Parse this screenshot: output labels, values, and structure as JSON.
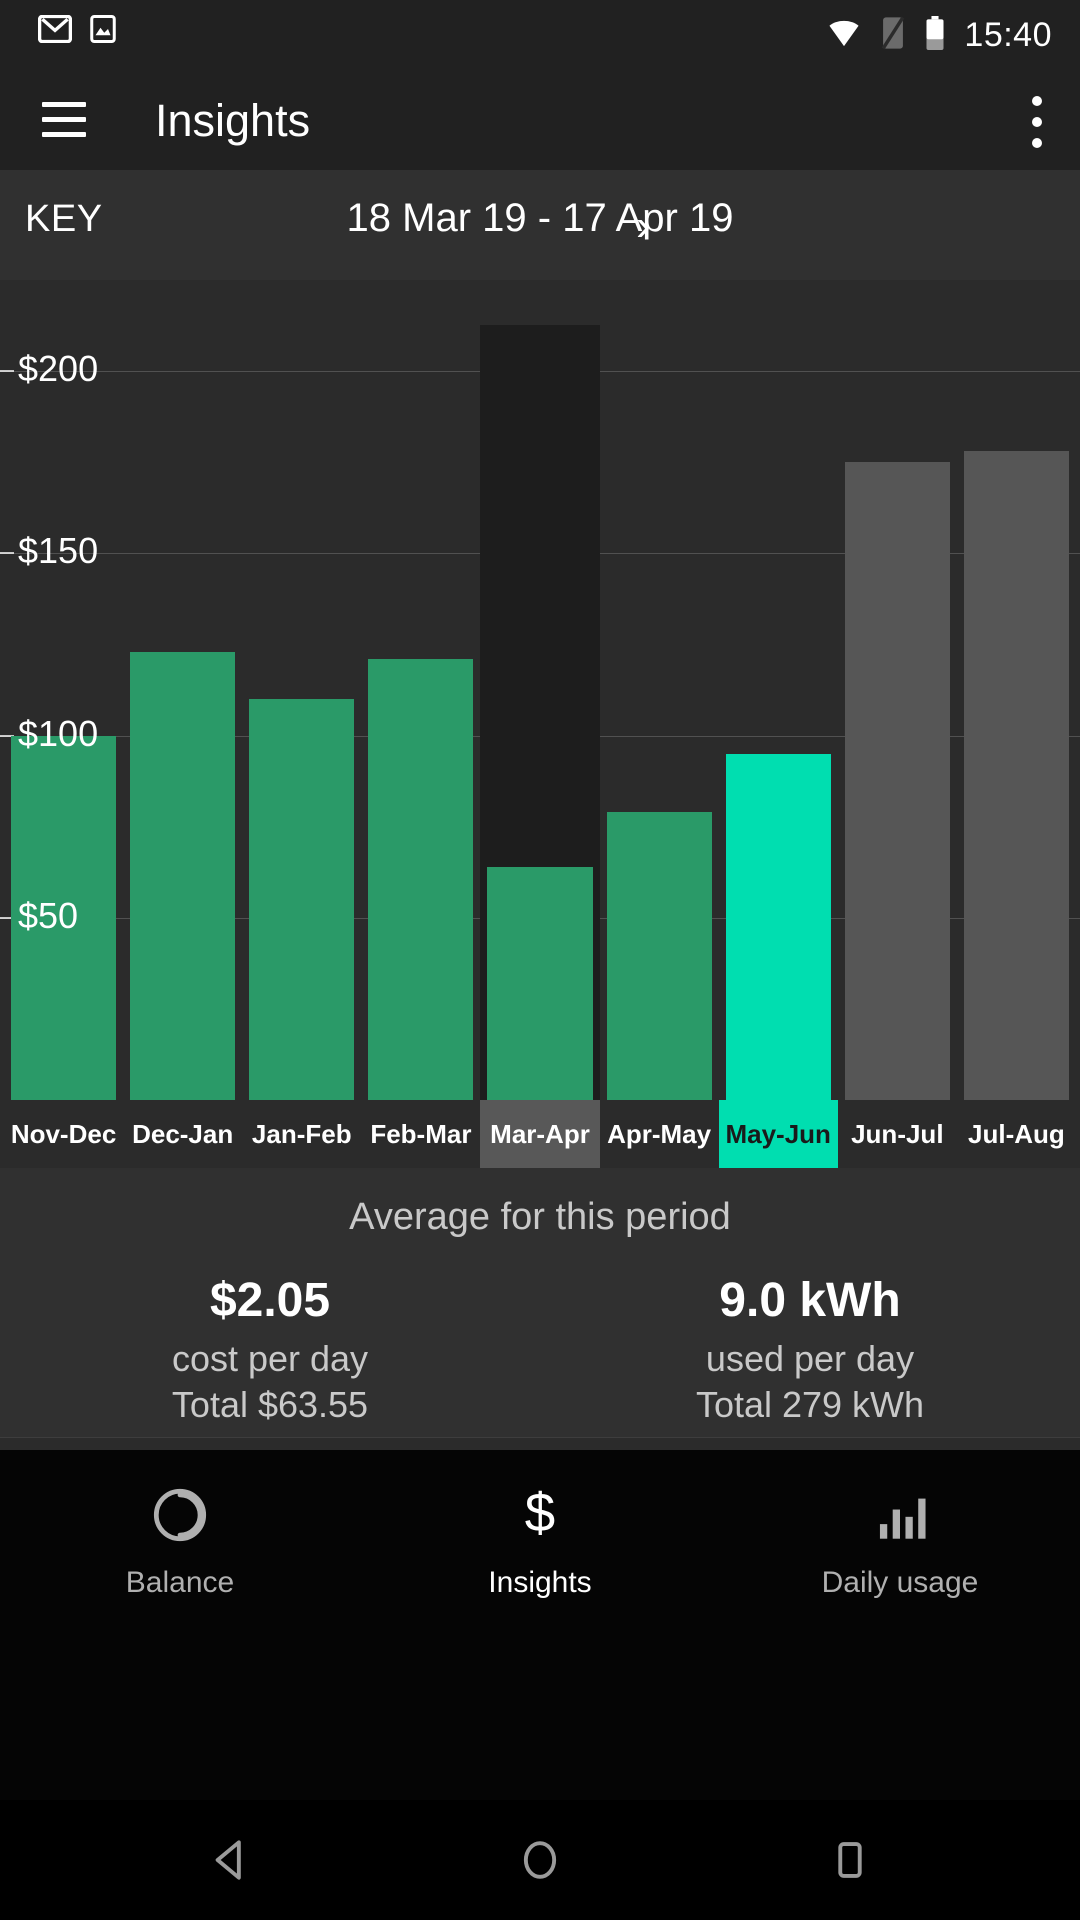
{
  "status_bar": {
    "time": "15:40",
    "icons": [
      "gmail-icon",
      "image-icon",
      "wifi-icon",
      "sim-off-icon",
      "battery-icon"
    ]
  },
  "app_bar": {
    "title": "Insights",
    "menu_icon": "hamburger-icon",
    "overflow_icon": "kebab-menu-icon"
  },
  "range_bar": {
    "key_label": "KEY",
    "range_text": "18 Mar 19 - 17 Apr 19",
    "next_icon": "›"
  },
  "chart_data": {
    "type": "bar",
    "title": "",
    "xlabel": "",
    "ylabel": "",
    "ylim": [
      0,
      225
    ],
    "grid": true,
    "ytick_labels": [
      "$200",
      "$150",
      "$100",
      "$50"
    ],
    "ytick_values": [
      200,
      150,
      100,
      50
    ],
    "categories": [
      "Nov-Dec",
      "Dec-Jan",
      "Jan-Feb",
      "Feb-Mar",
      "Mar-Apr",
      "Apr-May",
      "May-Jun",
      "Jun-Jul",
      "Jul-Aug"
    ],
    "values": [
      100,
      123,
      110,
      121,
      64,
      79,
      95,
      175,
      178
    ],
    "states": [
      "past",
      "past",
      "past",
      "past",
      "past",
      "past",
      "current",
      "future",
      "future"
    ],
    "highlighted_column": "Mar-Apr",
    "selected_column": "May-Jun",
    "colors": {
      "past": "#2a9a68",
      "current": "#00deb0",
      "future": "#565656",
      "highlight_column_bg": "#1d1d1d",
      "label_selected_grey_bg": "#585858",
      "plot_bg": "#2b2b2b",
      "gridline": "rgba(255,255,255,0.18)"
    }
  },
  "summary": {
    "title": "Average for this period",
    "stats": [
      {
        "value": "$2.05",
        "unit": "cost per day",
        "total": "Total $63.55"
      },
      {
        "value": "9.0 kWh",
        "unit": "used per day",
        "total": "Total 279 kWh"
      }
    ]
  },
  "bottom_nav": {
    "items": [
      {
        "label": "Balance",
        "icon": "balance-circle-icon",
        "active": false
      },
      {
        "label": "Insights",
        "icon": "dollar-icon",
        "active": true
      },
      {
        "label": "Daily usage",
        "icon": "bar-chart-icon",
        "active": false
      }
    ]
  },
  "android_nav": {
    "back": "back-triangle-icon",
    "home": "home-circle-icon",
    "recents": "recents-square-icon"
  }
}
